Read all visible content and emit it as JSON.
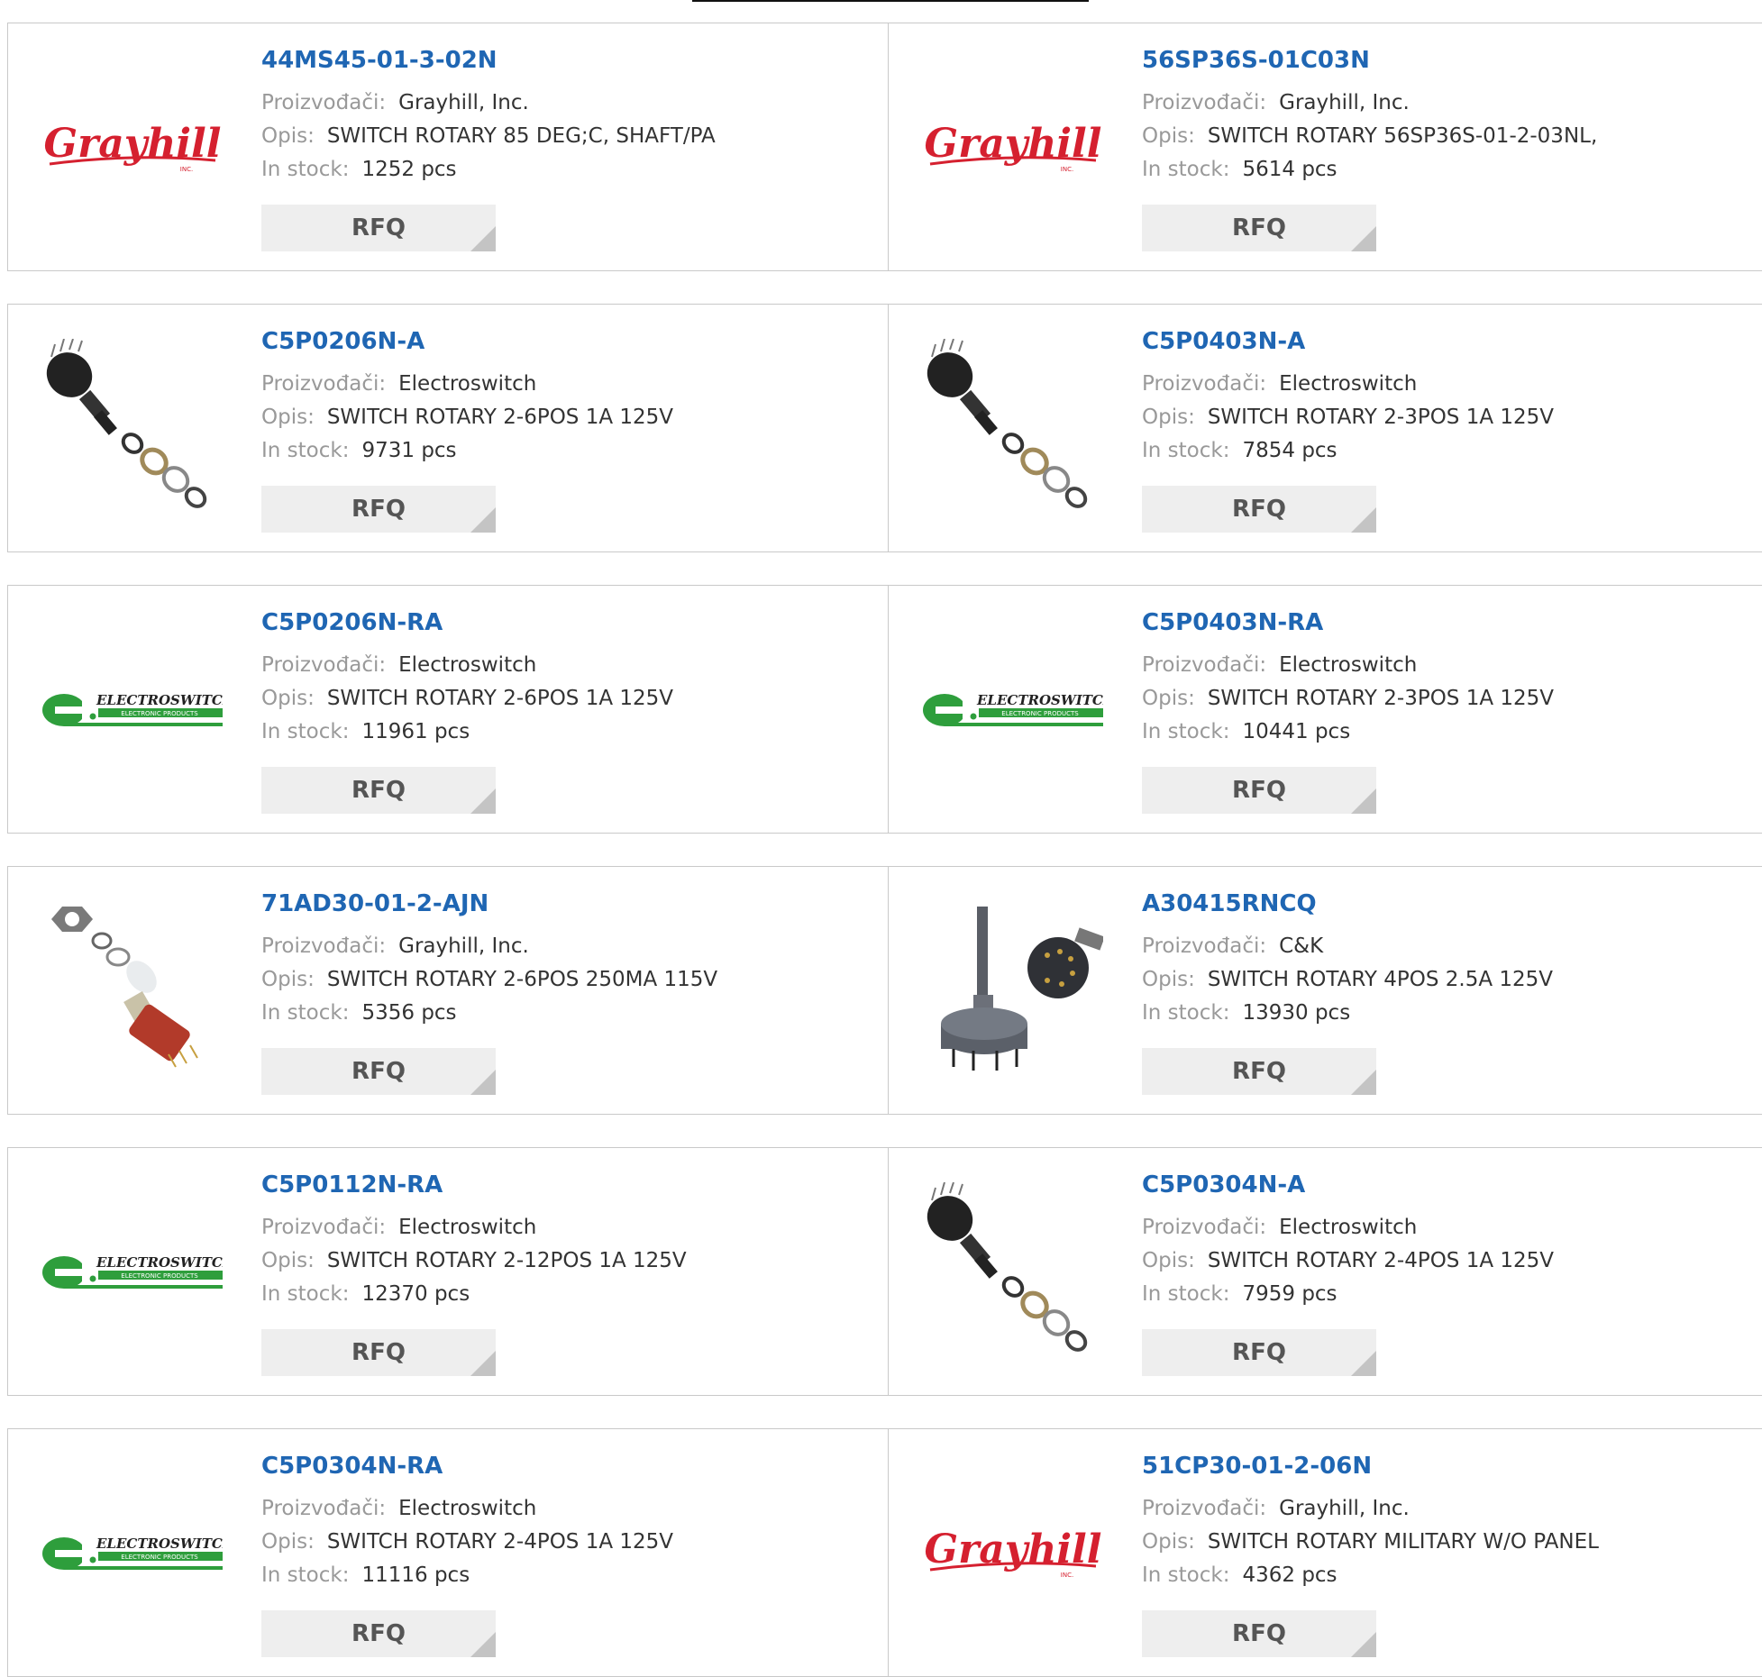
{
  "labels": {
    "manufacturer": "Proizvođači:",
    "description": "Opis:",
    "stock": "In stock:",
    "rfq": "RFQ"
  },
  "logos": {
    "grayhill": {
      "main": "Grayhill",
      "sub": "INC."
    },
    "electroswitch": {
      "main": "ELECTROSWITCH",
      "sub": "ELECTRONIC PRODUCTS"
    }
  },
  "colors": {
    "link": "#1f66b3",
    "grayhill_red": "#d5202f",
    "electroswitch_green": "#2e9e3c",
    "button_bg": "#eeeeee"
  },
  "products": [
    {
      "part": "44MS45-01-3-02N",
      "manufacturer": "Grayhill, Inc.",
      "description": "SWITCH ROTARY 85 DEG;C, SHAFT/PA",
      "stock": "1252 pcs",
      "image": "grayhill-logo"
    },
    {
      "part": "56SP36S-01C03N",
      "manufacturer": "Grayhill, Inc.",
      "description": "SWITCH ROTARY 56SP36S-01-2-03NL,",
      "stock": "5614 pcs",
      "image": "grayhill-logo"
    },
    {
      "part": "C5P0206N-A",
      "manufacturer": "Electroswitch",
      "description": "SWITCH ROTARY 2-6POS 1A 125V",
      "stock": "9731 pcs",
      "image": "rotary-switch-rings"
    },
    {
      "part": "C5P0403N-A",
      "manufacturer": "Electroswitch",
      "description": "SWITCH ROTARY 2-3POS 1A 125V",
      "stock": "7854 pcs",
      "image": "rotary-switch-rings"
    },
    {
      "part": "C5P0206N-RA",
      "manufacturer": "Electroswitch",
      "description": "SWITCH ROTARY 2-6POS 1A 125V",
      "stock": "11961 pcs",
      "image": "electroswitch-logo"
    },
    {
      "part": "C5P0403N-RA",
      "manufacturer": "Electroswitch",
      "description": "SWITCH ROTARY 2-3POS 1A 125V",
      "stock": "10441 pcs",
      "image": "electroswitch-logo"
    },
    {
      "part": "71AD30-01-2-AJN",
      "manufacturer": "Grayhill, Inc.",
      "description": "SWITCH ROTARY 2-6POS 250MA 115V",
      "stock": "5356 pcs",
      "image": "rotary-switch-red"
    },
    {
      "part": "A30415RNCQ",
      "manufacturer": "C&K",
      "description": "SWITCH ROTARY 4POS 2.5A 125V",
      "stock": "13930 pcs",
      "image": "rotary-switch-gray"
    },
    {
      "part": "C5P0112N-RA",
      "manufacturer": "Electroswitch",
      "description": "SWITCH ROTARY 2-12POS 1A 125V",
      "stock": "12370 pcs",
      "image": "electroswitch-logo"
    },
    {
      "part": "C5P0304N-A",
      "manufacturer": "Electroswitch",
      "description": "SWITCH ROTARY 2-4POS 1A 125V",
      "stock": "7959 pcs",
      "image": "rotary-switch-rings"
    },
    {
      "part": "C5P0304N-RA",
      "manufacturer": "Electroswitch",
      "description": "SWITCH ROTARY 2-4POS 1A 125V",
      "stock": "11116 pcs",
      "image": "electroswitch-logo"
    },
    {
      "part": "51CP30-01-2-06N",
      "manufacturer": "Grayhill, Inc.",
      "description": "SWITCH ROTARY MILITARY W/O PANEL",
      "stock": "4362 pcs",
      "image": "grayhill-logo"
    }
  ]
}
